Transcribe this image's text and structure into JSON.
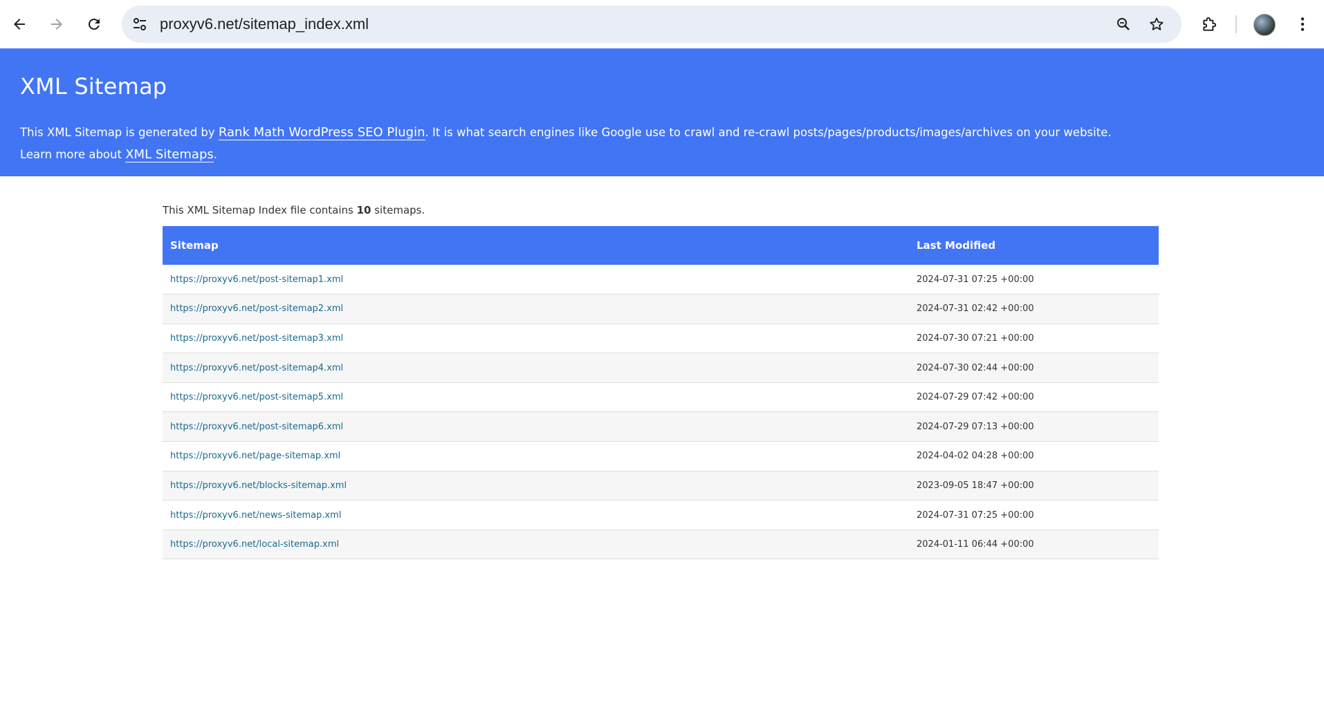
{
  "browser": {
    "url": "proxyv6.net/sitemap_index.xml",
    "icons": {
      "back": "back-arrow-icon",
      "forward": "forward-arrow-icon",
      "reload": "reload-icon",
      "site_info": "tune-icon",
      "zoom": "zoom-icon",
      "bookmark": "star-icon",
      "extensions": "puzzle-icon",
      "menu": "kebab-menu-icon"
    }
  },
  "header": {
    "title": "XML Sitemap",
    "desc_prefix": "This XML Sitemap is generated by ",
    "plugin_link": "Rank Math WordPress SEO Plugin",
    "desc_suffix": ". It is what search engines like Google use to crawl and re-crawl posts/pages/products/images/archives on your website.",
    "learn_prefix": "Learn more about ",
    "learn_link": "XML Sitemaps",
    "learn_suffix": ".",
    "bg_color": "#4275f4"
  },
  "summary": {
    "prefix": "This XML Sitemap Index file contains ",
    "count": "10",
    "suffix": " sitemaps."
  },
  "table": {
    "headers": {
      "sitemap": "Sitemap",
      "modified": "Last Modified"
    },
    "rows": [
      {
        "url": "https://proxyv6.net/post-sitemap1.xml",
        "modified": "2024-07-31 07:25 +00:00"
      },
      {
        "url": "https://proxyv6.net/post-sitemap2.xml",
        "modified": "2024-07-31 02:42 +00:00"
      },
      {
        "url": "https://proxyv6.net/post-sitemap3.xml",
        "modified": "2024-07-30 07:21 +00:00"
      },
      {
        "url": "https://proxyv6.net/post-sitemap4.xml",
        "modified": "2024-07-30 02:44 +00:00"
      },
      {
        "url": "https://proxyv6.net/post-sitemap5.xml",
        "modified": "2024-07-29 07:42 +00:00"
      },
      {
        "url": "https://proxyv6.net/post-sitemap6.xml",
        "modified": "2024-07-29 07:13 +00:00"
      },
      {
        "url": "https://proxyv6.net/page-sitemap.xml",
        "modified": "2024-04-02 04:28 +00:00"
      },
      {
        "url": "https://proxyv6.net/blocks-sitemap.xml",
        "modified": "2023-09-05 18:47 +00:00"
      },
      {
        "url": "https://proxyv6.net/news-sitemap.xml",
        "modified": "2024-07-31 07:25 +00:00"
      },
      {
        "url": "https://proxyv6.net/local-sitemap.xml",
        "modified": "2024-01-11 06:44 +00:00"
      }
    ]
  }
}
